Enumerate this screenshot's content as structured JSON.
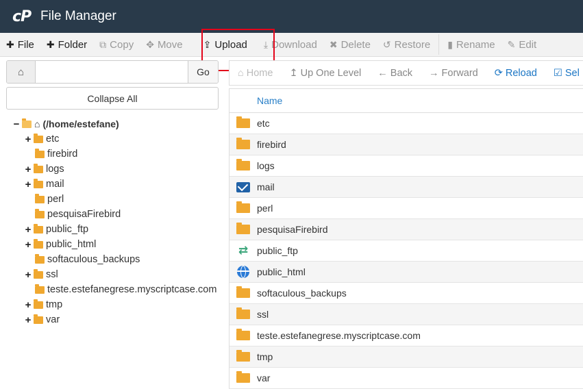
{
  "header": {
    "logo": "cP",
    "title": "File Manager"
  },
  "toolbar": {
    "file": "File",
    "folder": "Folder",
    "copy": "Copy",
    "move": "Move",
    "upload": "Upload",
    "download": "Download",
    "delete": "Delete",
    "restore": "Restore",
    "rename": "Rename",
    "edit": "Edit"
  },
  "left": {
    "path_value": "",
    "go": "Go",
    "collapse_all": "Collapse All",
    "root": "(/home/estefane)",
    "tree": [
      {
        "name": "etc",
        "expandable": true
      },
      {
        "name": "firebird",
        "expandable": false
      },
      {
        "name": "logs",
        "expandable": true
      },
      {
        "name": "mail",
        "expandable": true
      },
      {
        "name": "perl",
        "expandable": false
      },
      {
        "name": "pesquisaFirebird",
        "expandable": false
      },
      {
        "name": "public_ftp",
        "expandable": true
      },
      {
        "name": "public_html",
        "expandable": true
      },
      {
        "name": "softaculous_backups",
        "expandable": false
      },
      {
        "name": "ssl",
        "expandable": true
      },
      {
        "name": "teste.estefanegrese.myscriptcase.com",
        "expandable": false
      },
      {
        "name": "tmp",
        "expandable": true
      },
      {
        "name": "var",
        "expandable": true
      }
    ]
  },
  "nav": {
    "home": "Home",
    "up": "Up One Level",
    "back": "Back",
    "forward": "Forward",
    "reload": "Reload",
    "select": "Sel"
  },
  "table": {
    "header_name": "Name",
    "rows": [
      {
        "name": "etc",
        "icon": "folder-icon"
      },
      {
        "name": "firebird",
        "icon": "folder-icon"
      },
      {
        "name": "logs",
        "icon": "folder-icon"
      },
      {
        "name": "mail",
        "icon": "mail-icon"
      },
      {
        "name": "perl",
        "icon": "folder-icon"
      },
      {
        "name": "pesquisaFirebird",
        "icon": "folder-icon"
      },
      {
        "name": "public_ftp",
        "icon": "transfer-icon"
      },
      {
        "name": "public_html",
        "icon": "globe-icon"
      },
      {
        "name": "softaculous_backups",
        "icon": "folder-icon"
      },
      {
        "name": "ssl",
        "icon": "folder-icon"
      },
      {
        "name": "teste.estefanegrese.myscriptcase.com",
        "icon": "folder-icon"
      },
      {
        "name": "tmp",
        "icon": "folder-icon"
      },
      {
        "name": "var",
        "icon": "folder-icon"
      }
    ]
  },
  "colors": {
    "header_bg": "#293a4a",
    "link_blue": "#2a80c8",
    "folder": "#f0a830",
    "highlight": "#e3051b"
  }
}
